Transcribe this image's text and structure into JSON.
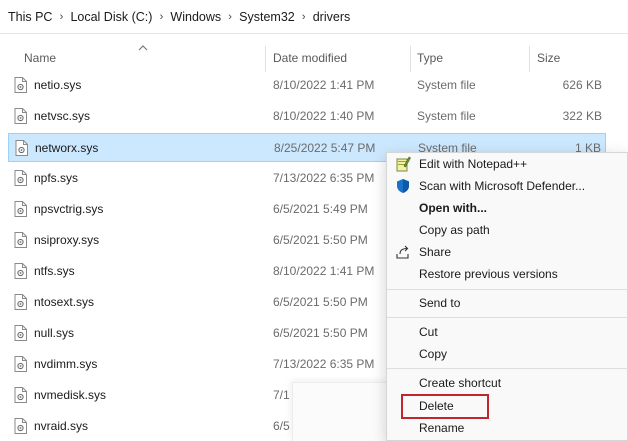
{
  "breadcrumb": [
    "This PC",
    "Local Disk (C:)",
    "Windows",
    "System32",
    "drivers"
  ],
  "breadcrumb_separator": "›",
  "columns": {
    "name": "Name",
    "date_modified": "Date modified",
    "type": "Type",
    "size": "Size"
  },
  "files": [
    {
      "name": "netio.sys",
      "date": "8/10/2022 1:41 PM",
      "type": "System file",
      "size": "626 KB"
    },
    {
      "name": "netvsc.sys",
      "date": "8/10/2022 1:40 PM",
      "type": "System file",
      "size": "322 KB"
    },
    {
      "name": "networx.sys",
      "date": "8/25/2022 5:47 PM",
      "type": "System file",
      "size": "1 KB"
    },
    {
      "name": "npfs.sys",
      "date": "7/13/2022 6:35 PM",
      "type": "",
      "size": ""
    },
    {
      "name": "npsvctrig.sys",
      "date": "6/5/2021 5:49 PM",
      "type": "",
      "size": ""
    },
    {
      "name": "nsiproxy.sys",
      "date": "6/5/2021 5:50 PM",
      "type": "",
      "size": ""
    },
    {
      "name": "ntfs.sys",
      "date": "8/10/2022 1:41 PM",
      "type": "",
      "size": ""
    },
    {
      "name": "ntosext.sys",
      "date": "6/5/2021 5:50 PM",
      "type": "",
      "size": ""
    },
    {
      "name": "null.sys",
      "date": "6/5/2021 5:50 PM",
      "type": "",
      "size": ""
    },
    {
      "name": "nvdimm.sys",
      "date": "7/13/2022 6:35 PM",
      "type": "",
      "size": ""
    },
    {
      "name": "nvmedisk.sys",
      "date": "7/1",
      "type": "",
      "size": ""
    },
    {
      "name": "nvraid.sys",
      "date": "6/5",
      "type": "",
      "size": ""
    }
  ],
  "selected_file": "networx.sys",
  "context_menu": {
    "edit_notepad": "Edit with Notepad++",
    "scan_defender": "Scan with Microsoft Defender...",
    "open_with": "Open with...",
    "copy_as_path": "Copy as path",
    "share": "Share",
    "restore_versions": "Restore previous versions",
    "send_to": "Send to",
    "cut": "Cut",
    "copy": "Copy",
    "create_shortcut": "Create shortcut",
    "delete": "Delete",
    "rename": "Rename"
  },
  "colors": {
    "selection_fill": "#cce8ff",
    "selection_border": "#99d1ff",
    "highlight_box": "#c0262c"
  },
  "icons": {
    "file": "system-file-icon",
    "notepad": "notepad-plus-plus-icon",
    "defender": "defender-shield-icon",
    "copy_path": "copy-path-icon",
    "share": "share-icon"
  }
}
